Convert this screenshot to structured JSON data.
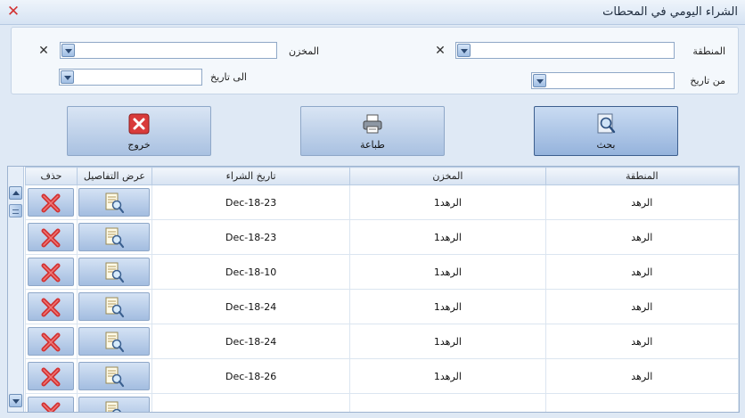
{
  "window": {
    "title": "الشراء اليومي في المحطات"
  },
  "filters": {
    "region_label": "المنطقة",
    "warehouse_label": "المخزن",
    "from_date_label": "من تاريخ",
    "to_date_label": "الى تاريخ",
    "region_value": "",
    "warehouse_value": "",
    "from_date_value": "",
    "to_date_value": ""
  },
  "actions": {
    "search_label": "بحث",
    "print_label": "طباعة",
    "exit_label": "خروج"
  },
  "grid": {
    "columns": [
      "المنطقة",
      "المخزن",
      "تاريخ الشراء",
      "عرض التفاصيل",
      "حذف"
    ],
    "rows": [
      {
        "region": "الرهد",
        "warehouse": "الرهد1",
        "date": "Dec-18-23"
      },
      {
        "region": "الرهد",
        "warehouse": "الرهد1",
        "date": "Dec-18-23"
      },
      {
        "region": "الرهد",
        "warehouse": "الرهد1",
        "date": "Dec-18-10"
      },
      {
        "region": "الرهد",
        "warehouse": "الرهد1",
        "date": "Dec-18-24"
      },
      {
        "region": "الرهد",
        "warehouse": "الرهد1",
        "date": "Dec-18-24"
      },
      {
        "region": "الرهد",
        "warehouse": "الرهد1",
        "date": "Dec-18-26"
      },
      {
        "region": "",
        "warehouse": "",
        "date": ""
      }
    ]
  },
  "icons": {
    "close": "close-icon",
    "search": "search-icon",
    "print": "printer-icon",
    "exit": "exit-icon",
    "details": "details-icon",
    "delete": "delete-icon"
  },
  "colors": {
    "accent": "#3c5e8e",
    "delete_red": "#d23232",
    "header_bg": "#dfe9f5"
  }
}
